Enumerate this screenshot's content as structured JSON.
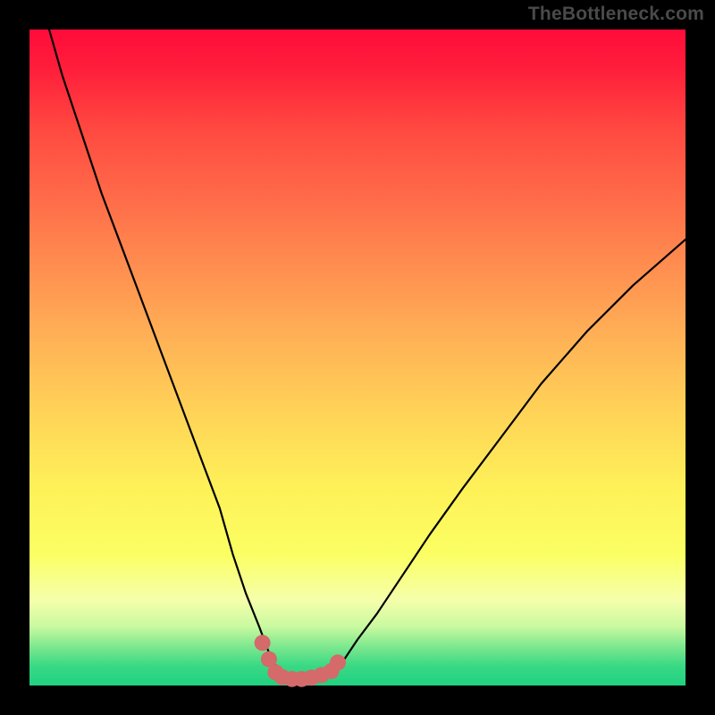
{
  "watermark": "TheBottleneck.com",
  "chart_data": {
    "type": "line",
    "title": "",
    "xlabel": "",
    "ylabel": "",
    "xlim": [
      0,
      100
    ],
    "ylim": [
      0,
      100
    ],
    "legend": false,
    "grid": false,
    "series": [
      {
        "name": "bottleneck-curve",
        "color": "#000000",
        "x": [
          3,
          5,
          8,
          11,
          14,
          17,
          20,
          23,
          26,
          29,
          31,
          33,
          35,
          36.5,
          38,
          40,
          42,
          44,
          46,
          48,
          50,
          53,
          57,
          61,
          66,
          72,
          78,
          85,
          92,
          100
        ],
        "values": [
          100,
          93,
          84,
          75,
          67,
          59,
          51,
          43,
          35,
          27,
          20,
          14,
          9,
          5,
          2,
          0.8,
          0.5,
          0.8,
          2,
          4,
          7,
          11,
          17,
          23,
          30,
          38,
          46,
          54,
          61,
          68
        ]
      },
      {
        "name": "optimal-zone-markers",
        "color": "#d46a6a",
        "x": [
          35.5,
          36.5,
          37.5,
          38.5,
          40,
          41.5,
          43,
          44.5,
          46,
          47
        ],
        "values": [
          6.5,
          4,
          2,
          1.3,
          1,
          1,
          1.2,
          1.6,
          2.2,
          3.5
        ]
      }
    ],
    "background_gradient": {
      "top": "#ff0b3a",
      "upper_mid": "#ff8a4f",
      "mid": "#ffd257",
      "lower_mid": "#fbff63",
      "bottom": "#20d181"
    }
  }
}
